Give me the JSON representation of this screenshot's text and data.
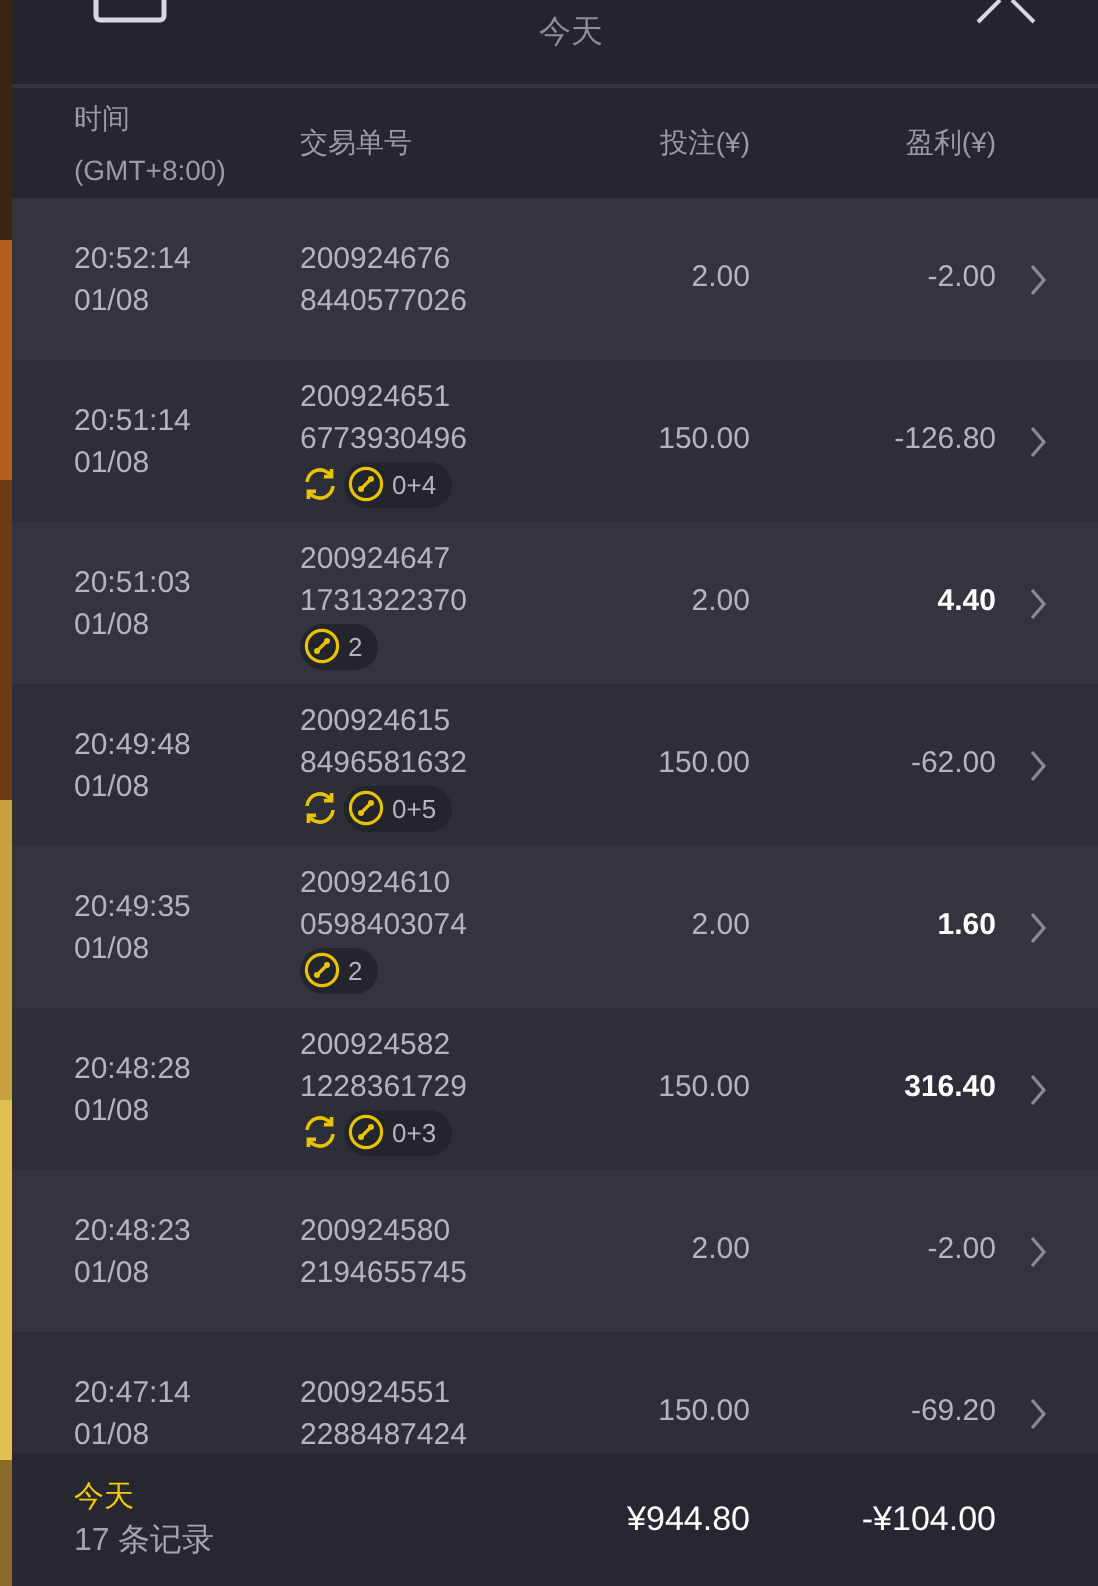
{
  "header": {
    "title": "今天"
  },
  "columns": {
    "time": "时间",
    "time_zone": "(GMT+8:00)",
    "order": "交易单号",
    "stake": "投注(¥)",
    "profit": "盈利(¥)"
  },
  "rows": [
    {
      "time": "20:52:14",
      "date": "01/08",
      "order_1": "200924676",
      "order_2": "8440577026",
      "stake": "2.00",
      "profit": "-2.00",
      "win": false,
      "renew": false
    },
    {
      "time": "20:51:14",
      "date": "01/08",
      "order_1": "200924651",
      "order_2": "6773930496",
      "stake": "150.00",
      "profit": "-126.80",
      "win": false,
      "renew": true,
      "parlay": "0+4"
    },
    {
      "time": "20:51:03",
      "date": "01/08",
      "order_1": "200924647",
      "order_2": "1731322370",
      "stake": "2.00",
      "profit": "4.40",
      "win": true,
      "renew": false,
      "parlay": "2"
    },
    {
      "time": "20:49:48",
      "date": "01/08",
      "order_1": "200924615",
      "order_2": "8496581632",
      "stake": "150.00",
      "profit": "-62.00",
      "win": false,
      "renew": true,
      "parlay": "0+5"
    },
    {
      "time": "20:49:35",
      "date": "01/08",
      "order_1": "200924610",
      "order_2": "0598403074",
      "stake": "2.00",
      "profit": "1.60",
      "win": true,
      "renew": false,
      "parlay": "2"
    },
    {
      "time": "20:48:28",
      "date": "01/08",
      "order_1": "200924582",
      "order_2": "1228361729",
      "stake": "150.00",
      "profit": "316.40",
      "win": true,
      "renew": true,
      "parlay": "0+3"
    },
    {
      "time": "20:48:23",
      "date": "01/08",
      "order_1": "200924580",
      "order_2": "2194655745",
      "stake": "2.00",
      "profit": "-2.00",
      "win": false,
      "renew": false
    },
    {
      "time": "20:47:14",
      "date": "01/08",
      "order_1": "200924551",
      "order_2": "2288487424",
      "stake": "150.00",
      "profit": "-69.20",
      "win": false,
      "renew": false
    }
  ],
  "footer": {
    "period": "今天",
    "count": "17 条记录",
    "total_stake": "¥944.80",
    "total_profit": "-¥104.00"
  }
}
